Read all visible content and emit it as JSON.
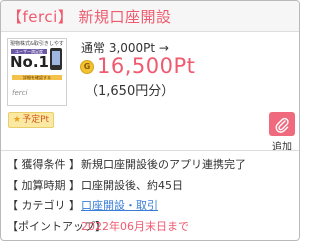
{
  "header": {
    "title": "【ferci】 新規口座開設"
  },
  "thumbnail": {
    "top_text": "現物株式&取引きしやすさ",
    "middle_text": "ユーザー満足度",
    "big_text": "No.1",
    "button_text": "詳細を確認する",
    "brand": "ferci"
  },
  "reward": {
    "normal_label": "通常 3,000Pt →",
    "coin_symbol": "G",
    "points": "16,500Pt",
    "yen": "（1,650円分）"
  },
  "tag": {
    "star": "★",
    "label": "予定Pt"
  },
  "add_button": {
    "label": "追加"
  },
  "details": [
    {
      "label": "【 獲得条件 】",
      "value": "新規口座開設後のアプリ連携完了"
    },
    {
      "label": "【 加算時期 】",
      "value": "口座開設後、約45日"
    },
    {
      "label": "【 カテゴリ 】",
      "value": "口座開設・取引"
    },
    {
      "label": "【ポイントアップ】",
      "value": "2022年06月末日まで"
    }
  ],
  "colors": {
    "accent": "#ef5a6f",
    "link": "#3a7dd8",
    "tag_bg": "#fbe9a3"
  }
}
